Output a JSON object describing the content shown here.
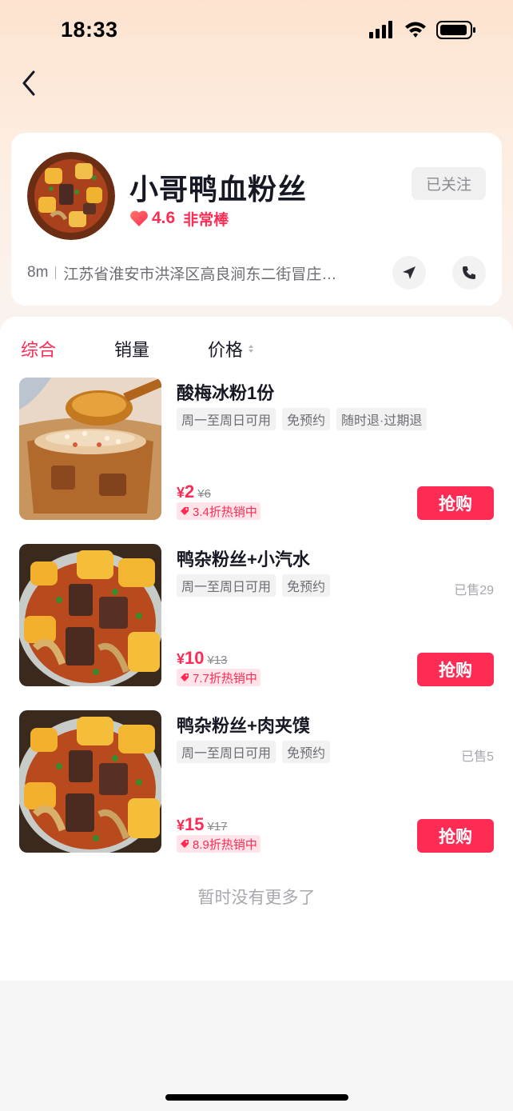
{
  "status_bar": {
    "time": "18:33",
    "signal_icon": "cellular-signal-icon",
    "wifi_icon": "wifi-icon",
    "battery_icon": "battery-icon"
  },
  "nav": {
    "back_icon": "chevron-left-icon"
  },
  "shop": {
    "name": "小哥鸭血粉丝",
    "rating_score": "4.6",
    "rating_label": "非常棒",
    "follow_label": "已关注",
    "distance": "8m",
    "address": "江苏省淮安市洪泽区高良涧东二街冒庄…",
    "nav_icon": "location-arrow-icon",
    "phone_icon": "phone-icon"
  },
  "sort_tabs": [
    {
      "label": "综合",
      "active": true
    },
    {
      "label": "销量",
      "active": false
    },
    {
      "label": "价格",
      "active": false
    }
  ],
  "deals": [
    {
      "title": "酸梅冰粉1份",
      "tags": [
        "周一至周日可用",
        "免预约",
        "随时退·过期退"
      ],
      "sold": "",
      "price": "2",
      "currency": "¥",
      "original_price": "¥6",
      "discount": "3.4折热销中",
      "buy_label": "抢购"
    },
    {
      "title": "鸭杂粉丝+小汽水",
      "tags": [
        "周一至周日可用",
        "免预约"
      ],
      "sold": "已售29",
      "price": "10",
      "currency": "¥",
      "original_price": "¥13",
      "discount": "7.7折热销中",
      "buy_label": "抢购"
    },
    {
      "title": "鸭杂粉丝+肉夹馍",
      "tags": [
        "周一至周日可用",
        "免预约"
      ],
      "sold": "已售5",
      "price": "15",
      "currency": "¥",
      "original_price": "¥17",
      "discount": "8.9折热销中",
      "buy_label": "抢购"
    }
  ],
  "footer": {
    "no_more": "暂时没有更多了"
  },
  "colors": {
    "accent": "#fe2c55",
    "text": "#161823",
    "muted": "#8a8b91"
  }
}
